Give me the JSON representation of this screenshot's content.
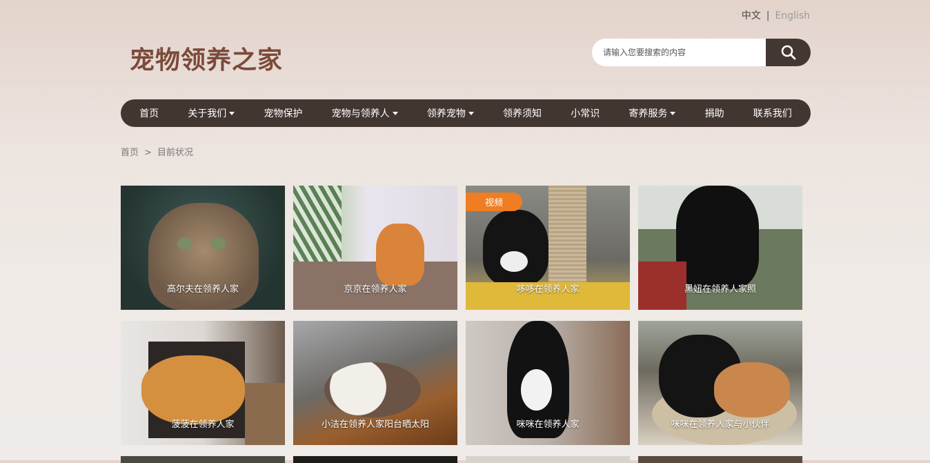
{
  "lang": {
    "zh": "中文",
    "sep": "|",
    "en": "English"
  },
  "logo": "宠物领养之家",
  "search": {
    "placeholder": "请输入您要搜索的内容"
  },
  "nav": [
    {
      "label": "首页",
      "dropdown": false
    },
    {
      "label": "关于我们",
      "dropdown": true
    },
    {
      "label": "宠物保护",
      "dropdown": false
    },
    {
      "label": "宠物与领养人",
      "dropdown": true
    },
    {
      "label": "领养宠物",
      "dropdown": true
    },
    {
      "label": "领养须知",
      "dropdown": false
    },
    {
      "label": "小常识",
      "dropdown": false
    },
    {
      "label": "寄养服务",
      "dropdown": true
    },
    {
      "label": "捐助",
      "dropdown": false
    },
    {
      "label": "联系我们",
      "dropdown": false
    }
  ],
  "breadcrumb": {
    "home": "首页",
    "sep": ">",
    "current": "目前状况"
  },
  "cards": [
    {
      "caption": "高尔夫在领养人家",
      "badge": ""
    },
    {
      "caption": "京京在领养人家",
      "badge": ""
    },
    {
      "caption": "哆哆在领养人家",
      "badge": "视频"
    },
    {
      "caption": "黑妞在领养人家照",
      "badge": ""
    },
    {
      "caption": "菠菠在领养人家",
      "badge": ""
    },
    {
      "caption": "小洁在领养人家阳台晒太阳",
      "badge": ""
    },
    {
      "caption": "咪咪在领养人家",
      "badge": ""
    },
    {
      "caption": "咪咪在领养人家与小伙伴",
      "badge": ""
    }
  ]
}
